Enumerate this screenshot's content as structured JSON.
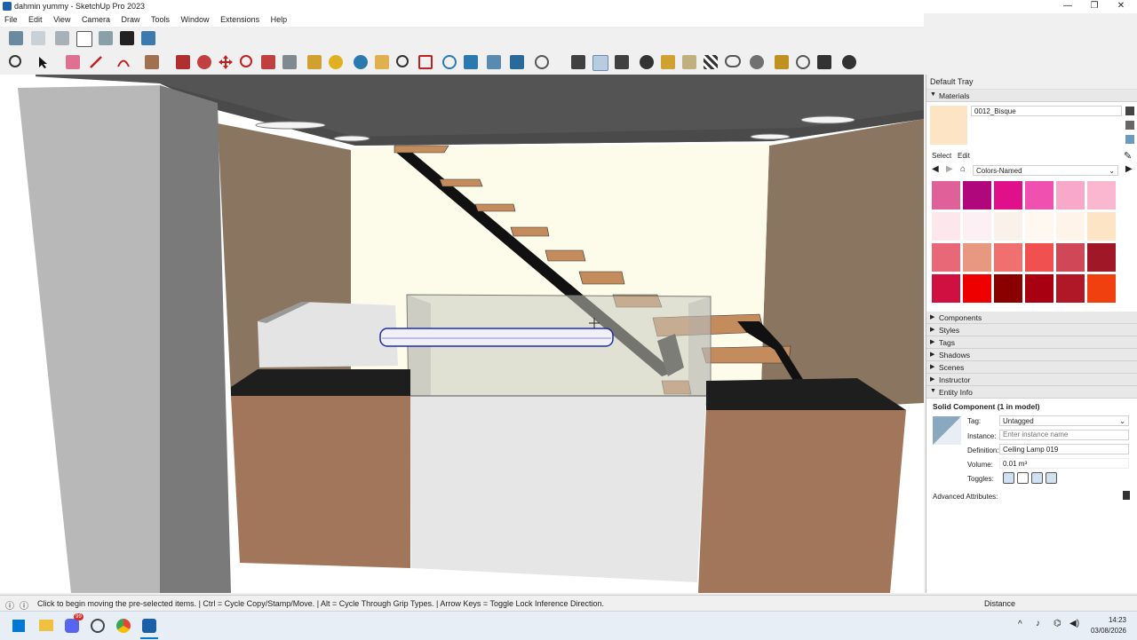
{
  "window": {
    "title": "dahmin yummy - SketchUp Pro 2023",
    "minimize": "—",
    "maximize": "❐",
    "close": "✕"
  },
  "menu": [
    "File",
    "Edit",
    "View",
    "Camera",
    "Draw",
    "Tools",
    "Window",
    "Extensions",
    "Help"
  ],
  "tray": {
    "title": "Default Tray",
    "materials": {
      "header": "Materials",
      "current_name": "0012_Bisque",
      "current_color": "#fce4c4",
      "tab_select": "Select",
      "tab_edit": "Edit",
      "library": "Colors-Named",
      "swatches": [
        "#e0609a",
        "#b0087c",
        "#e0108a",
        "#f050b0",
        "#f8a8c8",
        "#fab8d0",
        "#fce8ec",
        "#fcf0f4",
        "#faf2ea",
        "#fff8f0",
        "#fff4ea",
        "#fce4c4",
        "#e86878",
        "#e89880",
        "#f07070",
        "#f05050",
        "#d04858",
        "#a01828",
        "#d01040",
        "#ee0000",
        "#8a0000",
        "#a80010",
        "#b01828",
        "#f04010"
      ]
    },
    "sections": [
      "Components",
      "Styles",
      "Tags",
      "Shadows",
      "Scenes",
      "Instructor"
    ],
    "entity_info": {
      "header": "Entity Info",
      "title": "Solid Component (1 in model)",
      "tag_label": "Tag:",
      "tag_value": "Untagged",
      "instance_label": "Instance:",
      "instance_placeholder": "Enter instance name",
      "definition_label": "Definition:",
      "definition_value": "Ceiling Lamp 019",
      "volume_label": "Volume:",
      "volume_value": "0.01 m³",
      "toggles_label": "Toggles:",
      "advanced": "Advanced Attributes:"
    }
  },
  "status": {
    "message": "Click to begin moving the pre-selected items. | Ctrl = Cycle Copy/Stamp/Move. | Alt = Cycle Through Grip Types. | Arrow Keys = Toggle Lock Inference Direction.",
    "measure_label": "Distance"
  },
  "taskbar": {
    "time": "14:23",
    "date": "03/08/2026",
    "badge": "99"
  }
}
